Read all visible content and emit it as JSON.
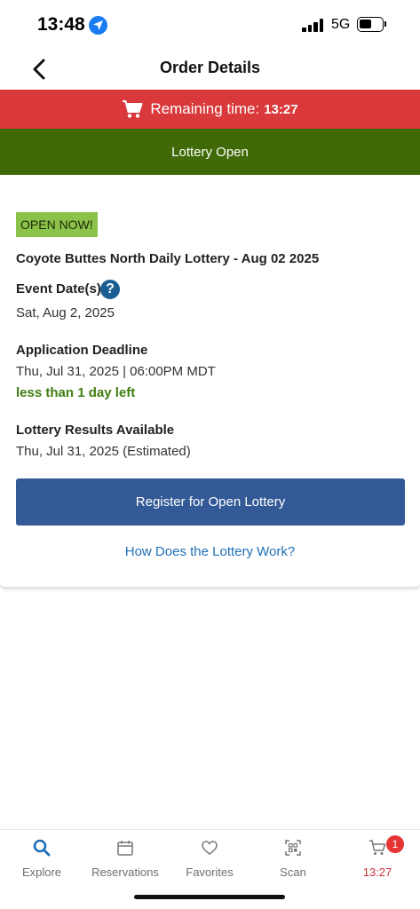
{
  "status_bar": {
    "time": "13:48",
    "network": "5G"
  },
  "nav": {
    "title": "Order Details"
  },
  "timer_banner": {
    "label": "Remaining time:",
    "time": "13:27",
    "color": "#d9393a"
  },
  "status_strip": {
    "text": "Lottery Open",
    "color": "#3f6a07"
  },
  "card": {
    "badge": "OPEN NOW!",
    "lottery_name": "Coyote Buttes North Daily Lottery - Aug 02 2025",
    "event_dates_label": "Event Date(s)",
    "event_dates_value": "Sat, Aug 2, 2025",
    "help_icon_glyph": "?",
    "deadline_label": "Application Deadline",
    "deadline_value": "Thu, Jul 31, 2025 | 06:00PM MDT",
    "time_left": "less than 1 day left",
    "results_label": "Lottery Results Available",
    "results_value": "Thu, Jul 31, 2025 (Estimated)",
    "register_button": "Register for Open Lottery",
    "how_link": "How Does the Lottery Work?"
  },
  "tab_bar": {
    "tabs": [
      {
        "label": "Explore",
        "icon": "search-icon"
      },
      {
        "label": "Reservations",
        "icon": "calendar-icon"
      },
      {
        "label": "Favorites",
        "icon": "heart-icon"
      },
      {
        "label": "Scan",
        "icon": "qr-scan-icon"
      },
      {
        "label": "13:27",
        "icon": "cart-icon",
        "badge": "1"
      }
    ],
    "accent_color": "#c8303a"
  }
}
